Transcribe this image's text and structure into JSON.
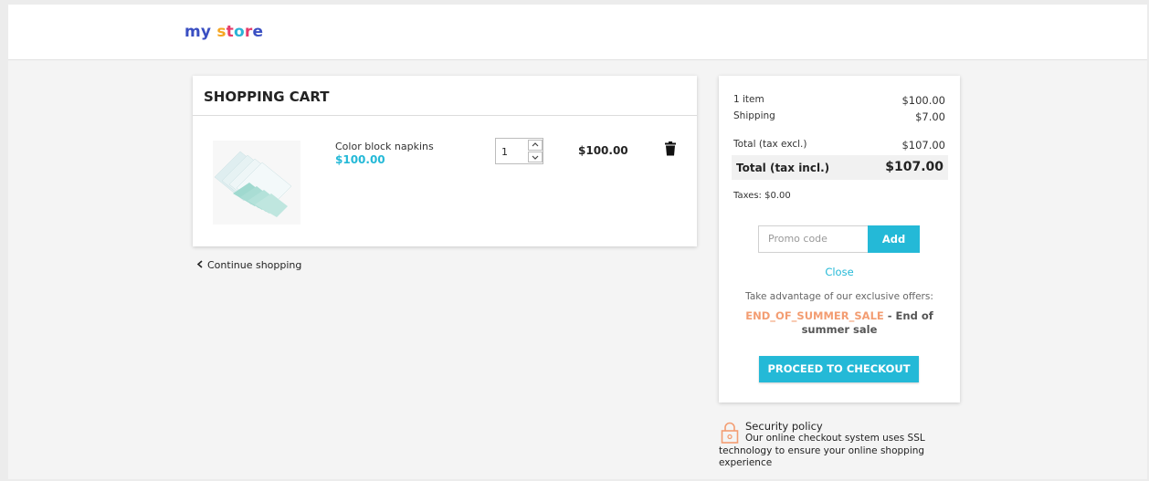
{
  "store": {
    "logo_letters": [
      {
        "ch": "m",
        "color": "#3a4fc2"
      },
      {
        "ch": "y",
        "color": "#3a4fc2"
      },
      {
        "ch": " ",
        "color": "#3a4fc2"
      },
      {
        "ch": "s",
        "color": "#f5a623"
      },
      {
        "ch": "t",
        "color": "#e53c6b"
      },
      {
        "ch": "o",
        "color": "#2bb3d6"
      },
      {
        "ch": "r",
        "color": "#e53c6b"
      },
      {
        "ch": "e",
        "color": "#3a4fc2"
      }
    ]
  },
  "cart": {
    "title": "SHOPPING CART",
    "item": {
      "name": "Color block napkins",
      "unit_price": "$100.00",
      "quantity": "1",
      "line_total": "$100.00"
    },
    "continue_label": "Continue shopping"
  },
  "summary": {
    "items_label": "1 item",
    "items_value": "$100.00",
    "shipping_label": "Shipping",
    "shipping_value": "$7.00",
    "total_excl_label": "Total (tax excl.)",
    "total_excl_value": "$107.00",
    "total_incl_label": "Total (tax incl.)",
    "total_incl_value": "$107.00",
    "taxes": "Taxes: $0.00",
    "promo_placeholder": "Promo code",
    "promo_add_label": "Add",
    "close_label": "Close",
    "offers_text": "Take advantage of our exclusive offers:",
    "offer_code": "END_OF_SUMMER_SALE",
    "offer_desc": " - End of summer sale",
    "checkout_label": "PROCEED TO CHECKOUT"
  },
  "security": {
    "title": "Security policy",
    "description": "Our online checkout system uses SSL technology to ensure your online shopping experience"
  },
  "colors": {
    "accent": "#24b9d7",
    "offer_code": "#f39d72"
  }
}
